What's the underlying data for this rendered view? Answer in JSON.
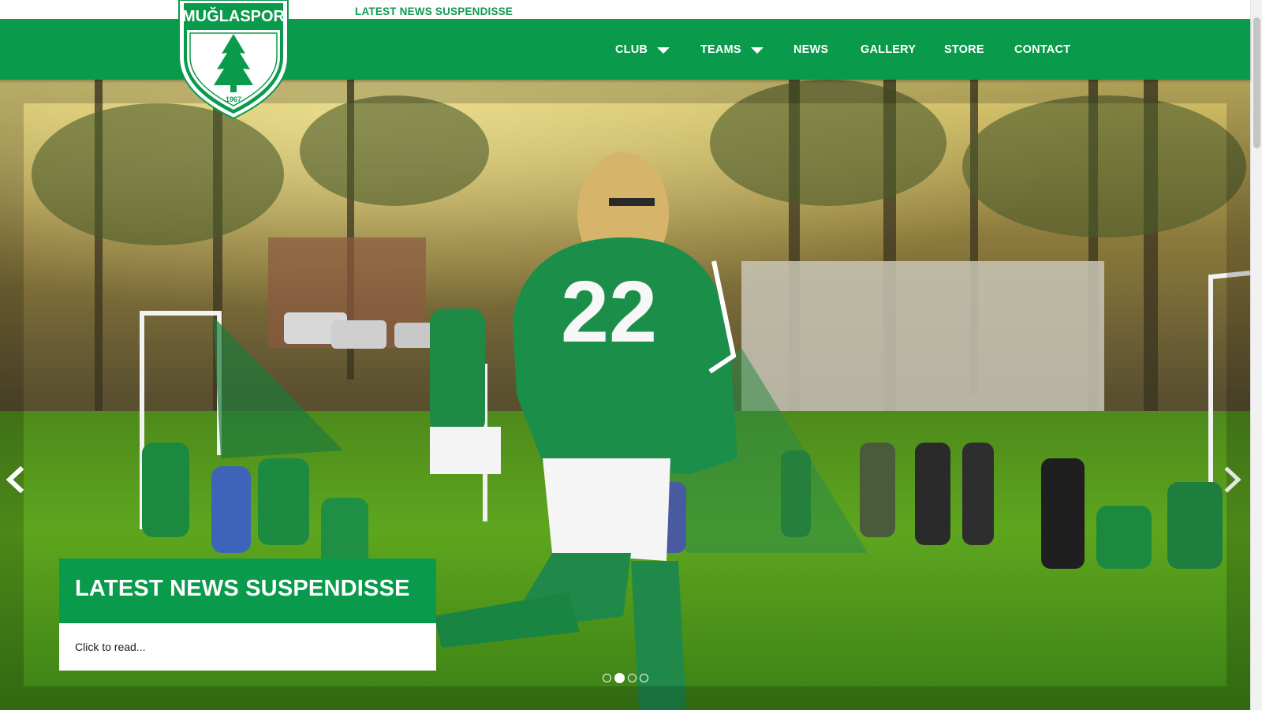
{
  "brand": {
    "name": "MUĞLASPOR",
    "year": "1967"
  },
  "ticker": {
    "text": "LATEST NEWS SUSPENDISSE"
  },
  "nav": {
    "items": [
      {
        "label": "CLUB",
        "dropdown": true
      },
      {
        "label": "TEAMS",
        "dropdown": true
      },
      {
        "label": "NEWS",
        "dropdown": false
      },
      {
        "label": "GALLERY",
        "dropdown": false
      },
      {
        "label": "STORE",
        "dropdown": false
      },
      {
        "label": "CONTACT",
        "dropdown": false
      }
    ]
  },
  "slider": {
    "caption_title": "LATEST NEWS SUSPENDISSE",
    "caption_link": "Click to read...",
    "player_number": "22",
    "slide_count": 4,
    "active_slide": 2,
    "icons": {
      "prev": "chevron-left-icon",
      "next": "chevron-right-icon"
    }
  },
  "colors": {
    "brand_green": "#0a9a4c",
    "ticker_green": "#0f9a4f",
    "white": "#ffffff"
  }
}
